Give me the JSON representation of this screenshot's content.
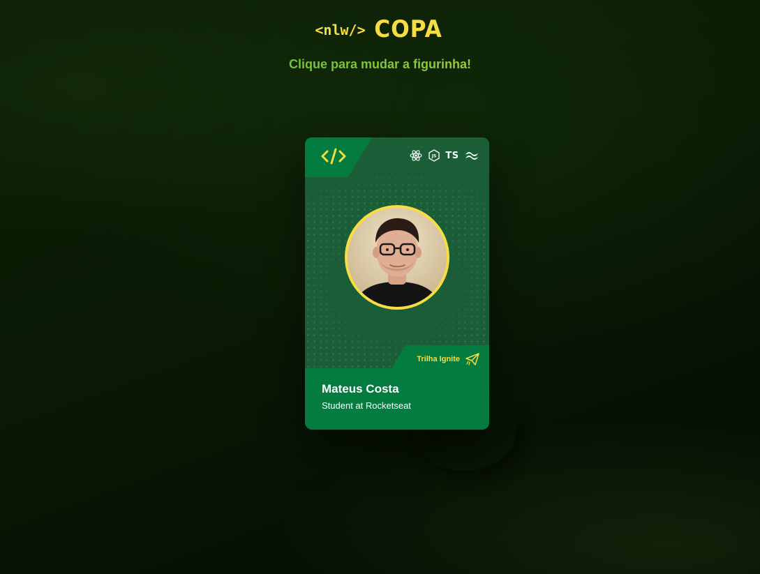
{
  "header": {
    "logo_tag": "<nlw/>",
    "logo_word": "COPA",
    "subtitle": "Clique para mudar a figurinha!"
  },
  "card": {
    "name": "Mateus Costa",
    "role": "Student at Rocketseat",
    "track": "Trilha Ignite",
    "tech_icons": [
      "react-icon",
      "nodejs-icon",
      "typescript-icon",
      "tailwind-icon"
    ],
    "ts_label": "TS"
  },
  "colors": {
    "accent_yellow": "#f7dd43",
    "card_green": "#047c3f",
    "card_dark_green": "#1b5d37",
    "background": "#0a1a05"
  }
}
